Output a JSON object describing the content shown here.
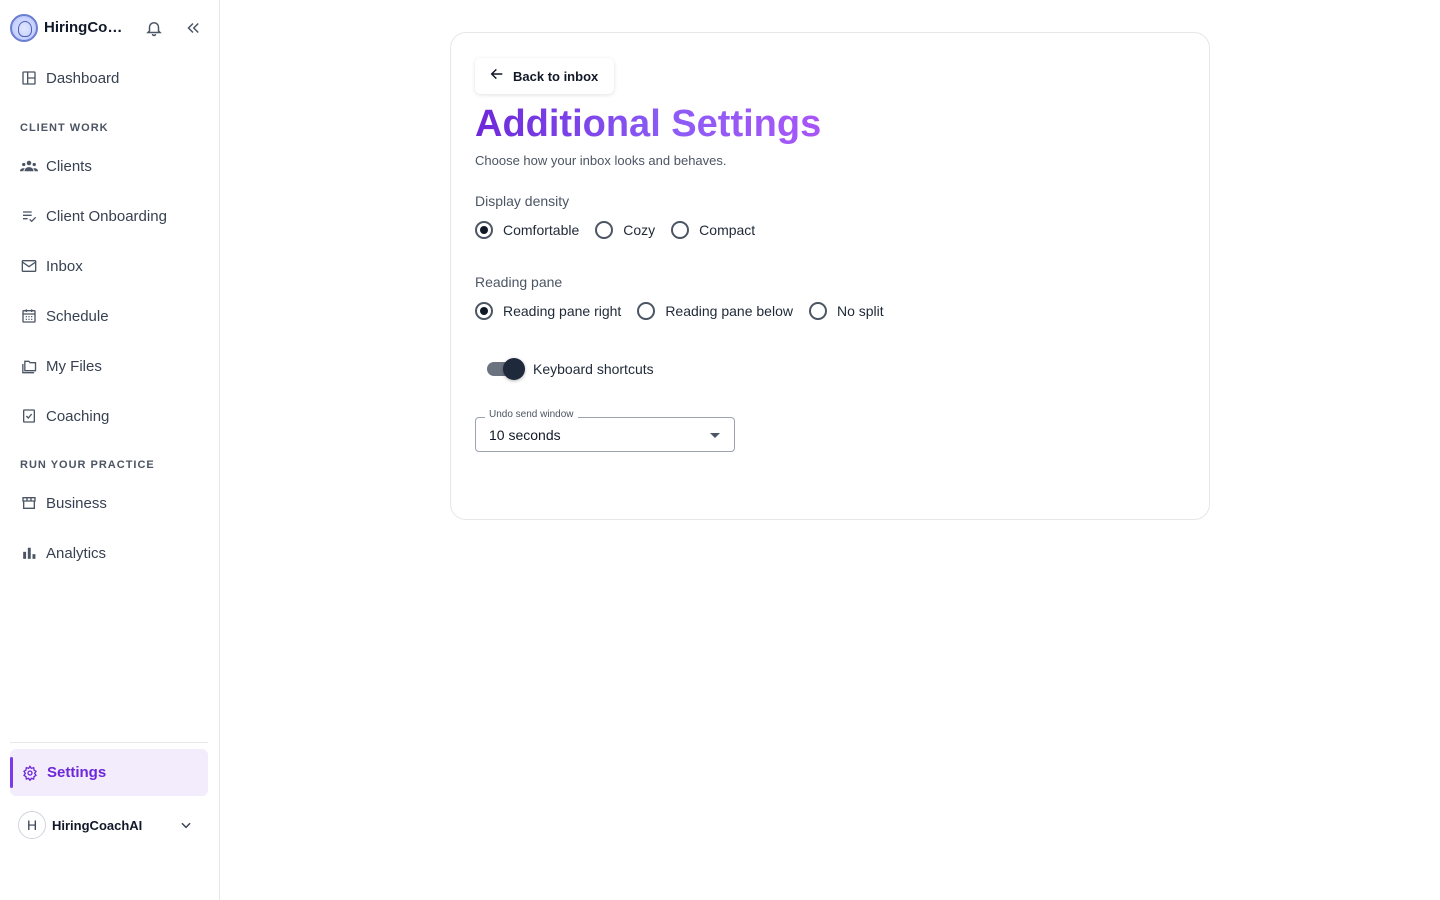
{
  "brand": {
    "name": "HiringCoachAI"
  },
  "sidebar": {
    "items": [
      {
        "label": "Dashboard",
        "icon": "dashboard-icon"
      },
      {
        "label": "Clients",
        "icon": "people-icon"
      },
      {
        "label": "Client Onboarding",
        "icon": "checklist-icon"
      },
      {
        "label": "Inbox",
        "icon": "mail-icon"
      },
      {
        "label": "Schedule",
        "icon": "calendar-icon"
      },
      {
        "label": "My Files",
        "icon": "folder-icon"
      },
      {
        "label": "Coaching",
        "icon": "clipboard-check-icon"
      },
      {
        "label": "Business",
        "icon": "storefront-icon"
      },
      {
        "label": "Analytics",
        "icon": "bar-chart-icon"
      }
    ],
    "sections": {
      "client_work": "CLIENT WORK",
      "run_practice": "RUN YOUR PRACTICE"
    },
    "settings_label": "Settings",
    "user": {
      "initial": "H",
      "name": "HiringCoachAI"
    }
  },
  "page": {
    "back_label": "Back to inbox",
    "title": "Additional Settings",
    "subtitle": "Choose how your inbox looks and behaves.",
    "display_density": {
      "label": "Display density",
      "options": [
        "Comfortable",
        "Cozy",
        "Compact"
      ],
      "selected": "Comfortable"
    },
    "reading_pane": {
      "label": "Reading pane",
      "options": [
        "Reading pane right",
        "Reading pane below",
        "No split"
      ],
      "selected": "Reading pane right"
    },
    "keyboard_shortcuts": {
      "label": "Keyboard shortcuts",
      "enabled": true
    },
    "undo_send": {
      "label": "Undo send window",
      "value": "10 seconds"
    }
  },
  "colors": {
    "accent": "#7c3aed",
    "accent_bg": "#f3ecfd",
    "title_gradient_start": "#6d28d9",
    "title_gradient_end": "#a855f7"
  }
}
